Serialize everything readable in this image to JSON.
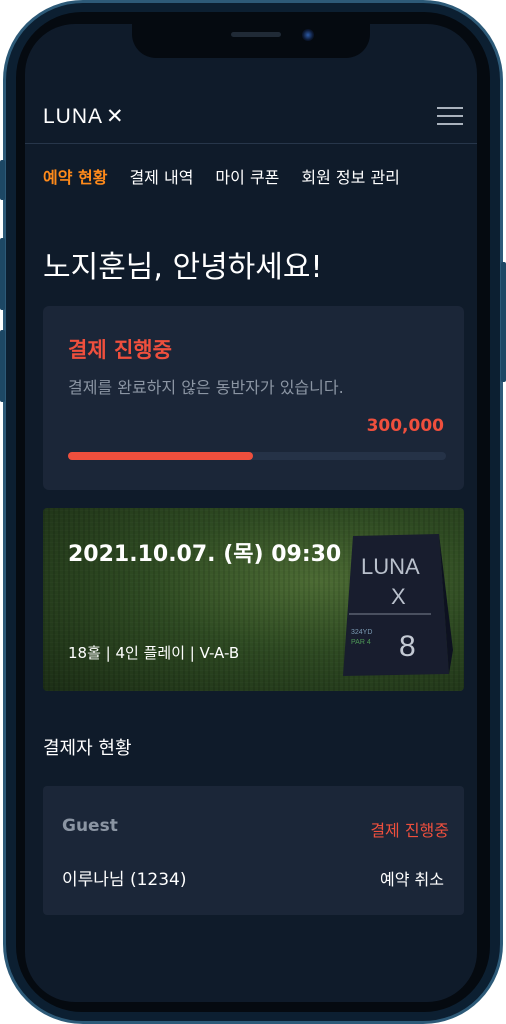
{
  "header": {
    "logo_text": "LUNA",
    "logo_mark": "✕"
  },
  "tabs": [
    {
      "label": "예약 현황",
      "active": true
    },
    {
      "label": "결제 내역",
      "active": false
    },
    {
      "label": "마이 쿠폰",
      "active": false
    },
    {
      "label": "회원 정보 관리",
      "active": false
    }
  ],
  "greeting": "노지훈님, 안녕하세요!",
  "payment": {
    "title": "결제 진행중",
    "description": "결제를 완료하지 않은 동반자가 있습니다.",
    "amount": "300,000",
    "progress": 0.49
  },
  "booking": {
    "datetime": "2021.10.07. (목) 09:30",
    "details": "18홀 | 4인 플레이 | V-A-B",
    "sign": {
      "brand": "LUNA",
      "mark": "X",
      "yardage": "324YD",
      "par": "PAR 4",
      "hole": "8"
    }
  },
  "payers": {
    "section_title": "결제자 현황",
    "guest_label": "Guest",
    "status": "결제 진행중",
    "name": "이루나님 (1234)",
    "cancel_label": "예약 취소"
  },
  "colors": {
    "accent_orange": "#ff8a1a",
    "accent_red": "#ef4f3d",
    "background": "#0f1b2a",
    "card": "#1b2638"
  }
}
